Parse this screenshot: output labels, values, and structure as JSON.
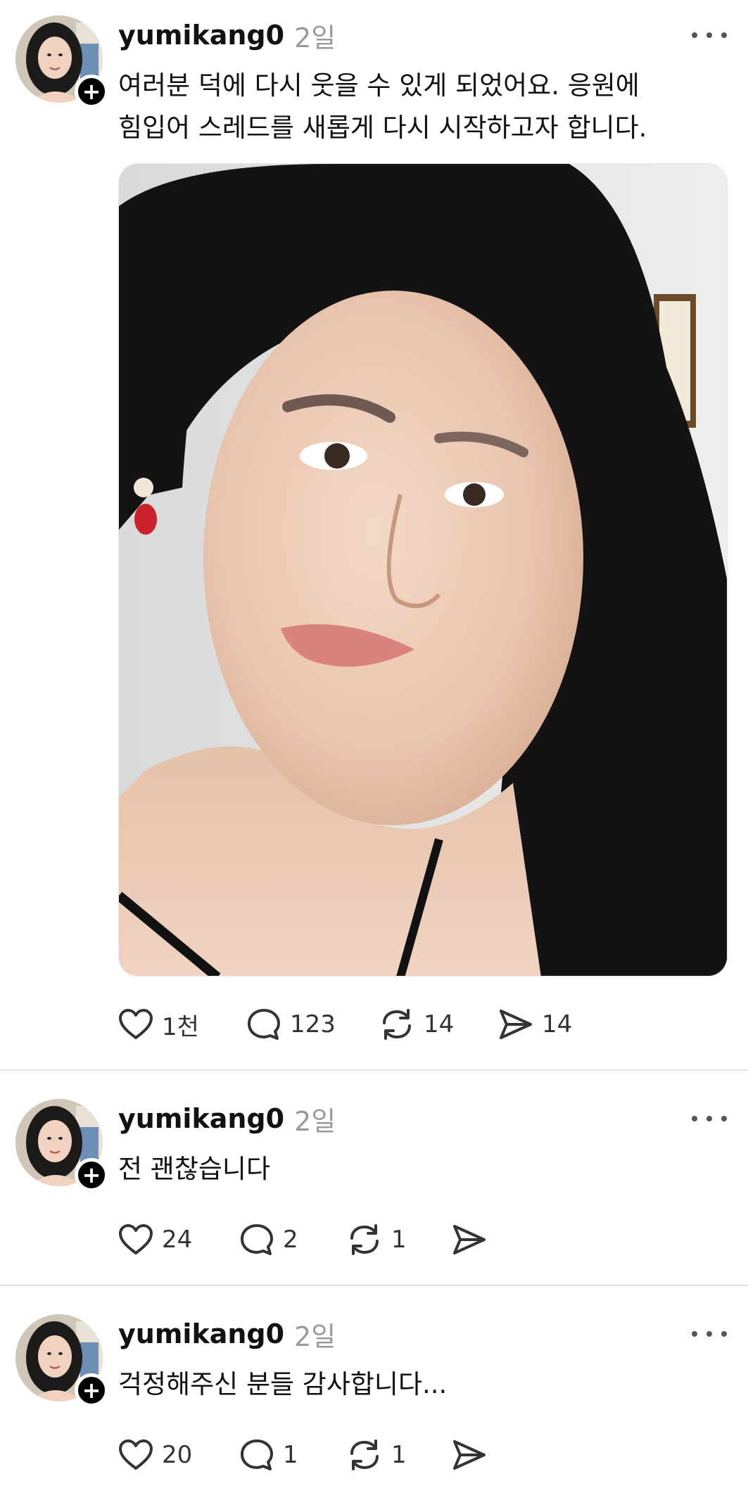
{
  "posts": [
    {
      "username": "yumikang0",
      "time": "2일",
      "text_line1": "여러분 덕에 다시 웃을 수 있게 되었어요. 응원에",
      "text_line2": "힘입어 스레드를 새롭게 다시 시작하고자 합니다.",
      "has_photo": true,
      "likes": "1천",
      "comments": "123",
      "reposts": "14",
      "shares": "14"
    },
    {
      "username": "yumikang0",
      "time": "2일",
      "text_line1": "전 괜찮습니다",
      "likes": "24",
      "comments": "2",
      "reposts": "1",
      "shares": ""
    },
    {
      "username": "yumikang0",
      "time": "2일",
      "text_line1": "걱정해주신 분들 감사합니다...",
      "likes": "20",
      "comments": "1",
      "reposts": "1",
      "shares": ""
    }
  ],
  "icons": {
    "like": "heart-icon",
    "comment": "comment-bubble-icon",
    "repost": "repost-icon",
    "share": "send-icon",
    "more": "more-dots-icon",
    "follow": "plus-icon"
  },
  "colors": {
    "text": "#111111",
    "muted": "#9a9a9a",
    "divider": "#e3e3e3",
    "badge": "#000000"
  }
}
